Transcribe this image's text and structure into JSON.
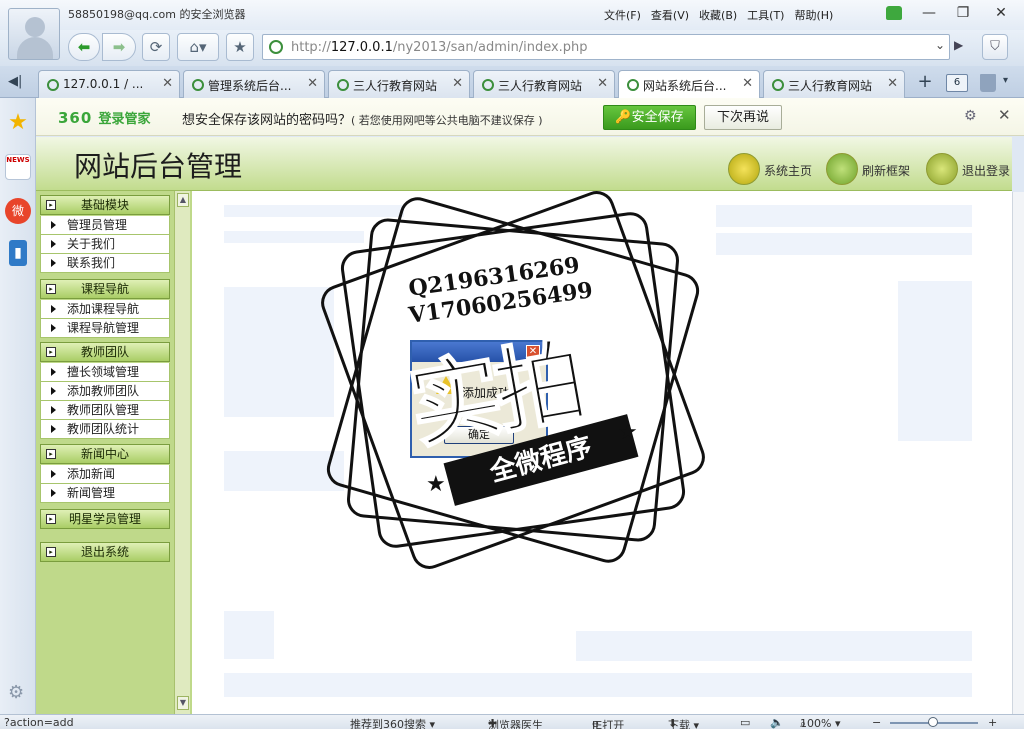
{
  "window": {
    "title": "58850198@qq.com 的安全浏览器",
    "menu": [
      "文件(F)",
      "查看(V)",
      "收藏(B)",
      "工具(T)",
      "帮助(H)"
    ],
    "minimize": "—",
    "maximize": "❐",
    "close": "✕"
  },
  "nav": {
    "back": "⬅",
    "forward": "➡",
    "refresh": "⟳",
    "home": "⌂▾",
    "favorite": "★",
    "url_prefix": "http://",
    "url_host": "127.0.0.1",
    "url_path": "/ny2013/san/admin/index.php",
    "dropdown": "⌄",
    "go": "▶",
    "shield": "⛉"
  },
  "tabs": {
    "toggle": "◀|",
    "items": [
      {
        "label": "127.0.0.1 / ...",
        "active": false
      },
      {
        "label": "管理系统后台...",
        "active": false
      },
      {
        "label": "三人行教育网站",
        "active": false
      },
      {
        "label": "三人行教育网站",
        "active": false
      },
      {
        "label": "网站系统后台...",
        "active": true
      },
      {
        "label": "三人行教育网站",
        "active": false
      }
    ],
    "close": "✕",
    "new_tab": "+",
    "count": "6",
    "trash_dropdown": "▾"
  },
  "sidebar": {
    "news_badge": "NEWS",
    "weibo": "微",
    "phone": "▮",
    "settings": "⚙"
  },
  "password_bar": {
    "logo_number": "360",
    "logo_text": "登录管家",
    "message": "想安全保存该网站的密码吗？",
    "note": "( 若您使用网吧等公共电脑不建议保存 )",
    "save_button": "安全保存",
    "later_button": "下次再说",
    "settings": "⚙",
    "close": "✕"
  },
  "admin": {
    "title": "网站后台管理",
    "header_links": {
      "home": "系统主页",
      "refresh_frame": "刷新框架",
      "logout": "退出登录"
    },
    "menu": {
      "basic": {
        "title": "基础模块",
        "items": [
          "管理员管理",
          "关于我们",
          "联系我们"
        ]
      },
      "course": {
        "title": "课程导航",
        "items": [
          "添加课程导航",
          "课程导航管理"
        ]
      },
      "teacher": {
        "title": "教师团队",
        "items": [
          "擅长领域管理",
          "添加教师团队",
          "教师团队管理",
          "教师团队统计"
        ]
      },
      "news": {
        "title": "新闻中心",
        "items": [
          "添加新闻",
          "新闻管理"
        ]
      },
      "star": {
        "title": "明星学员管理"
      },
      "exit": {
        "title": "退出系统"
      }
    },
    "scroll_up": "▲",
    "scroll_down": "▼"
  },
  "dialog": {
    "message": "添加成功",
    "ok_button": "确定",
    "close": "✕"
  },
  "watermark": {
    "qq": "Q2196316269",
    "v": "V17060256499",
    "main": "实拍",
    "ribbon": "全微程序",
    "star": "★"
  },
  "status": {
    "link": "?action=add",
    "recommend": "推荐到360搜索 ▾",
    "doctor": "浏览器医生",
    "ie_open": "IE打开",
    "download": "下载 ▾",
    "zoom": "100% ▾",
    "zoom_minus": "−",
    "zoom_plus": "+"
  }
}
